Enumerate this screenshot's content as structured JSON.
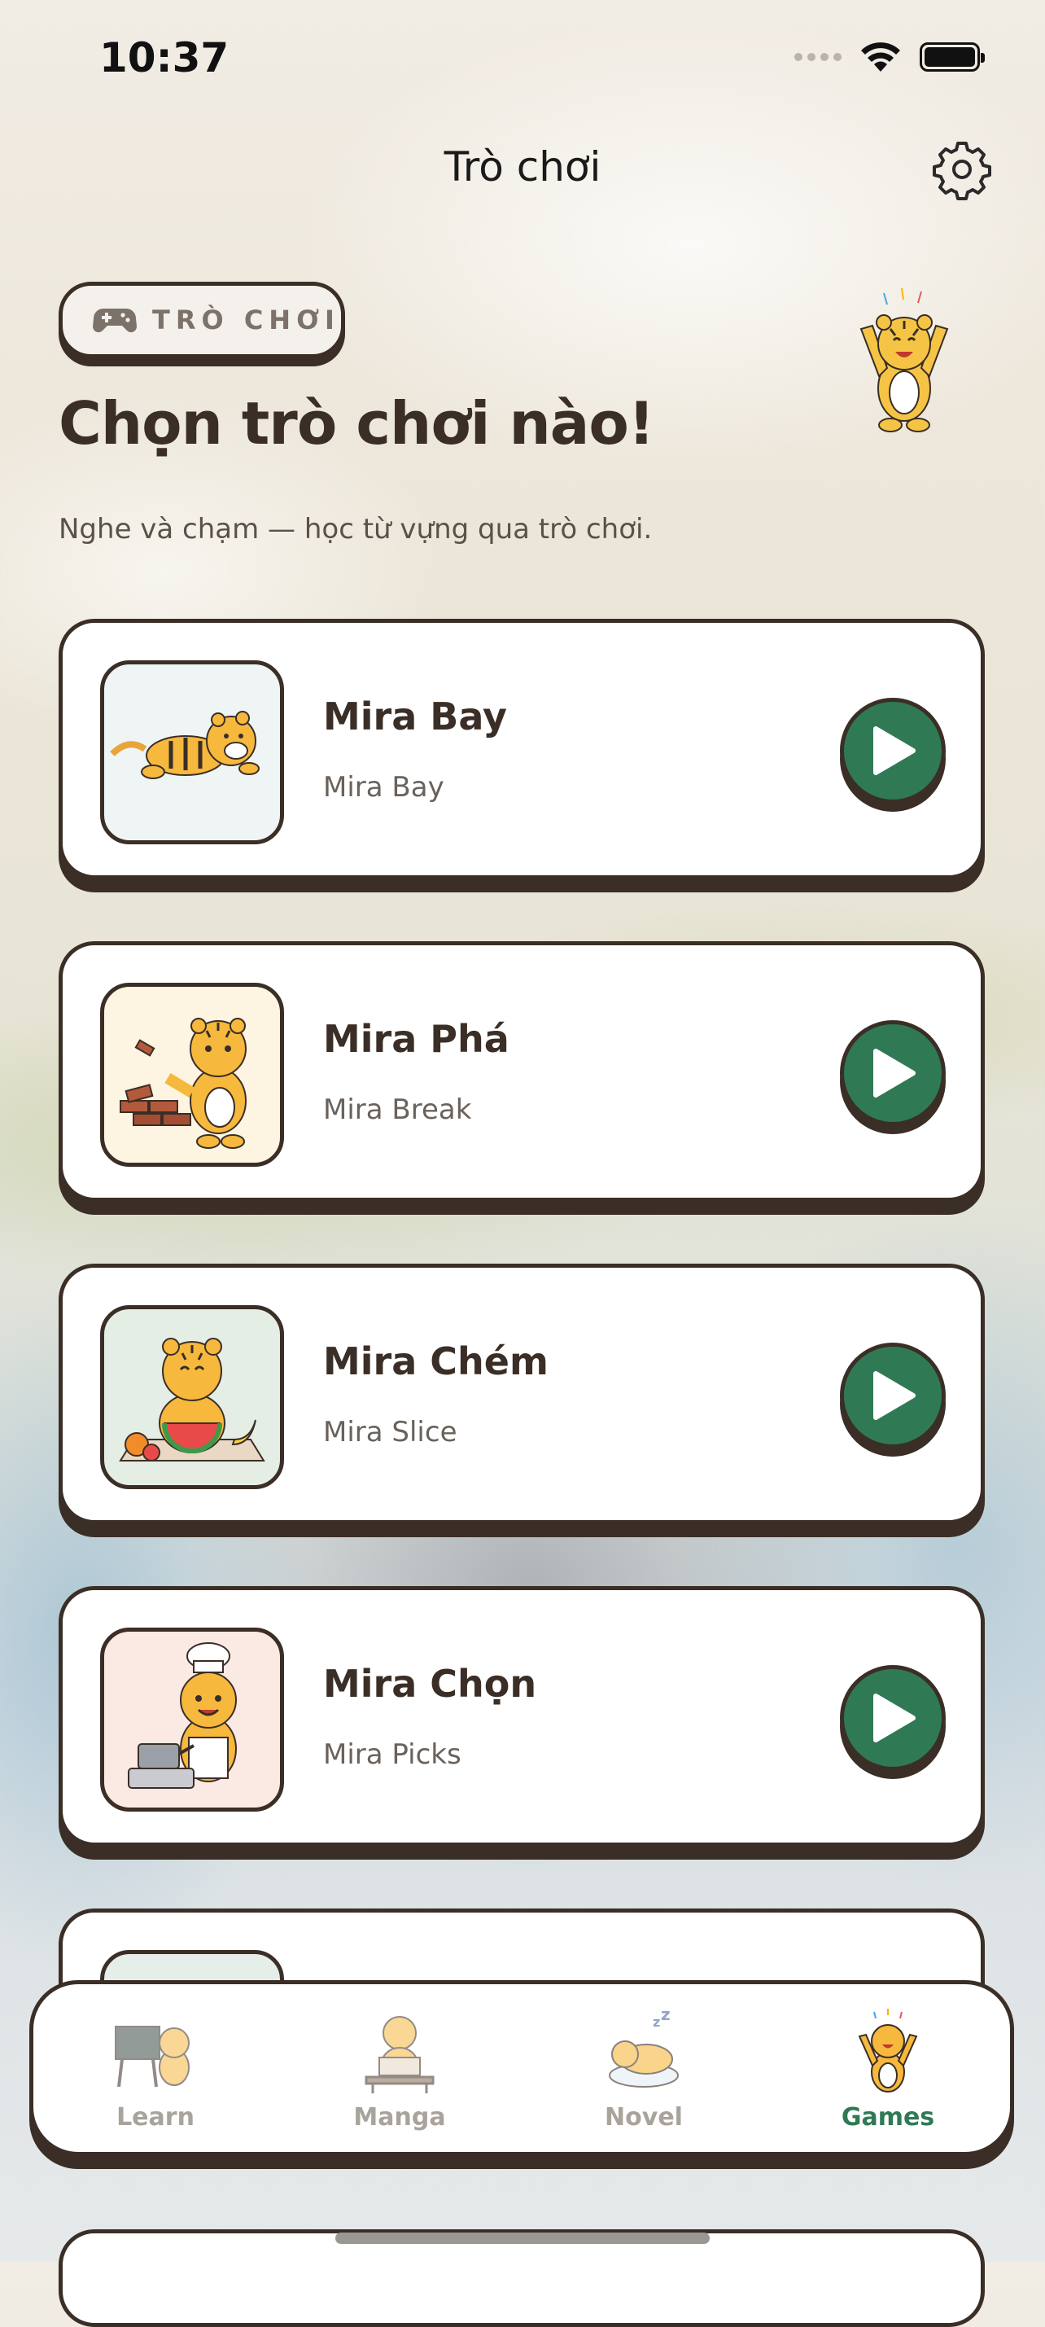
{
  "status_bar": {
    "time": "10:37"
  },
  "nav": {
    "title": "Trò chơi"
  },
  "section_pill": {
    "label": "TRÒ CHƠI",
    "icon": "gamepad-icon"
  },
  "heading": "Chọn trò chơi nào!",
  "subtitle": "Nghe và chạm — học từ vựng qua trò chơi.",
  "games": [
    {
      "title": "Mira Bay",
      "subtitle": "Mira Bay",
      "thumb_bg": "#eef5f4"
    },
    {
      "title": "Mira Phá",
      "subtitle": "Mira Break",
      "thumb_bg": "#fdf4e2"
    },
    {
      "title": "Mira Chém",
      "subtitle": "Mira Slice",
      "thumb_bg": "#e5eee5"
    },
    {
      "title": "Mira Chọn",
      "subtitle": "Mira Picks",
      "thumb_bg": "#fbe9e4"
    }
  ],
  "tabbar": {
    "tabs": [
      {
        "label": "Learn",
        "active": false
      },
      {
        "label": "Manga",
        "active": false
      },
      {
        "label": "Novel",
        "active": false
      },
      {
        "label": "Games",
        "active": true
      }
    ]
  },
  "colors": {
    "accent_green": "#2f7a55",
    "outline": "#3a2e26",
    "inactive_tab": "#a9a39c"
  }
}
